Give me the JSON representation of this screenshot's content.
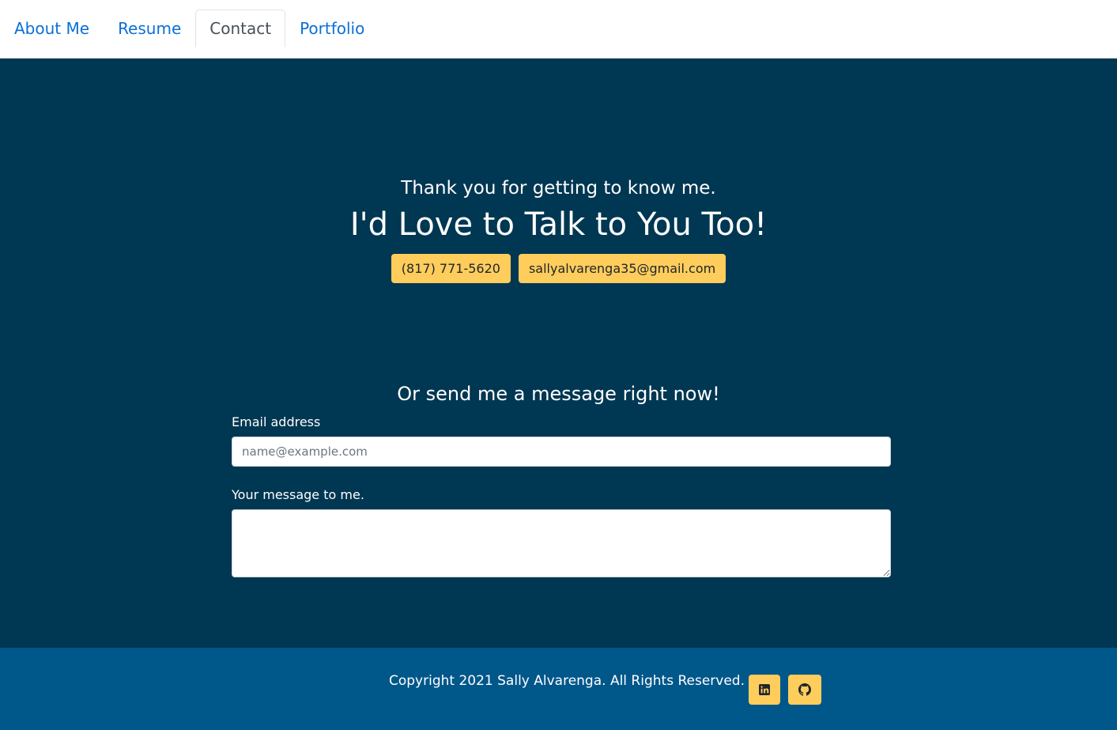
{
  "nav": {
    "tabs": [
      {
        "label": "About Me",
        "active": false
      },
      {
        "label": "Resume",
        "active": false
      },
      {
        "label": "Contact",
        "active": true
      },
      {
        "label": "Portfolio",
        "active": false
      }
    ]
  },
  "hero": {
    "subtitle": "Thank you for getting to know me.",
    "headline": "I'd Love to Talk to You Too!",
    "phone_button": "(817) 771-5620",
    "email_button": "sallyalvarenga35@gmail.com"
  },
  "form": {
    "title": "Or send me a message right now!",
    "email_label": "Email address",
    "email_placeholder": "name@example.com",
    "email_value": "",
    "message_label": "Your message to me.",
    "message_value": ""
  },
  "footer": {
    "copyright": "Copyright 2021 Sally Alvarenga. All Rights Reserved.",
    "icons": [
      "linkedin-icon",
      "github-icon"
    ]
  },
  "colors": {
    "main_bg": "#003752",
    "footer_bg": "#00578a",
    "accent": "#ffcd5c",
    "link": "#0a6fd8"
  }
}
